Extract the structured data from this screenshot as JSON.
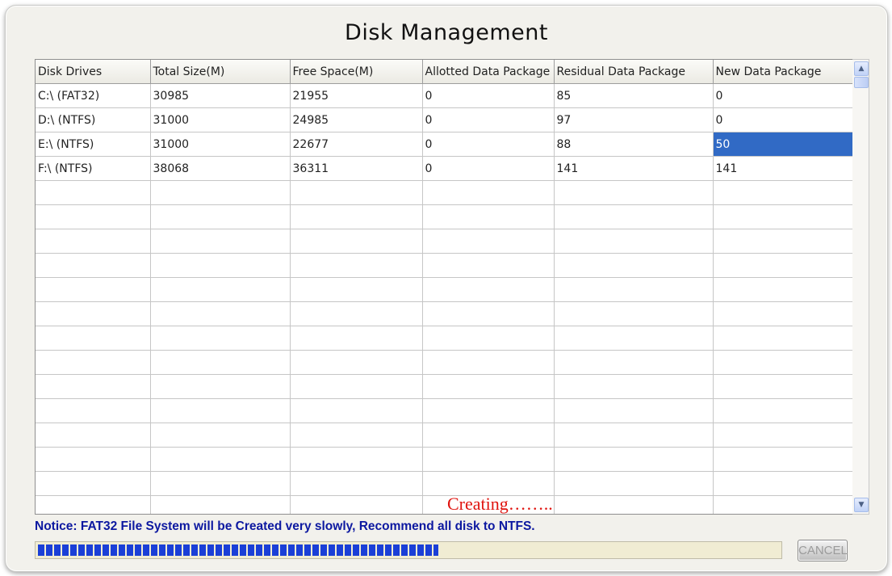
{
  "window": {
    "title": "Disk Management"
  },
  "table": {
    "columns": [
      "Disk Drives",
      "Total Size(M)",
      "Free Space(M)",
      "Allotted Data Package",
      "Residual Data Package",
      "New Data Package"
    ],
    "rows": [
      [
        "C:\\  (FAT32)",
        "30985",
        "21955",
        "0",
        "85",
        "0"
      ],
      [
        "D:\\  (NTFS)",
        "31000",
        "24985",
        "0",
        "97",
        "0"
      ],
      [
        "E:\\  (NTFS)",
        "31000",
        "22677",
        "0",
        "88",
        "50"
      ],
      [
        "F:\\  (NTFS)",
        "38068",
        "36311",
        "0",
        "141",
        "141"
      ]
    ],
    "selected_cell": {
      "row": 2,
      "column": 5
    }
  },
  "status_text": "Creating……..",
  "notice": "Notice:  FAT32 File System will be Created very slowly, Recommend all disk to NTFS.",
  "progress": {
    "fraction": 0.54
  },
  "buttons": {
    "cancel": "CANCEL"
  },
  "colors": {
    "status": "#e0140f",
    "notice": "#0c18a0",
    "progress_fill": "#1a3fd7",
    "selection": "#316ac5"
  },
  "icons": {
    "scroll_up": "chevron-up-icon",
    "scroll_down": "chevron-down-icon"
  }
}
